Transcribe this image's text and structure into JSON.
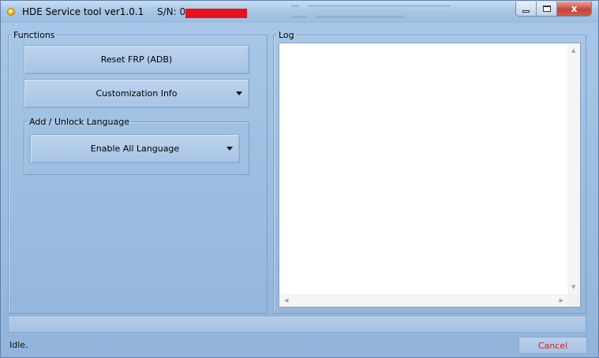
{
  "window": {
    "title": "HDE Service tool ver1.0.1",
    "serial_label": "S/N: 0",
    "serial_value": "XXXXXXXXXX",
    "close_glyph": "x"
  },
  "functions": {
    "legend": "Functions",
    "reset_frp_label": "Reset FRP (ADB)",
    "customization_label": "Customization Info",
    "language_group": {
      "legend": "Add / Unlock Language",
      "selected_option": "Enable All Language"
    }
  },
  "log": {
    "legend": "Log",
    "content": ""
  },
  "status_bar": {
    "status_text": "Idle.",
    "cancel_label": "Cancel",
    "progress": 0
  },
  "colors": {
    "window_bg": "#9fbfe0",
    "cancel_text": "#d41b1b",
    "serial_redaction": "#e8121c"
  },
  "icons": {
    "app": "app-icon",
    "dropdown": "chevron-down-icon",
    "minimize": "minimize-icon",
    "maximize": "maximize-icon",
    "close": "close-icon"
  }
}
